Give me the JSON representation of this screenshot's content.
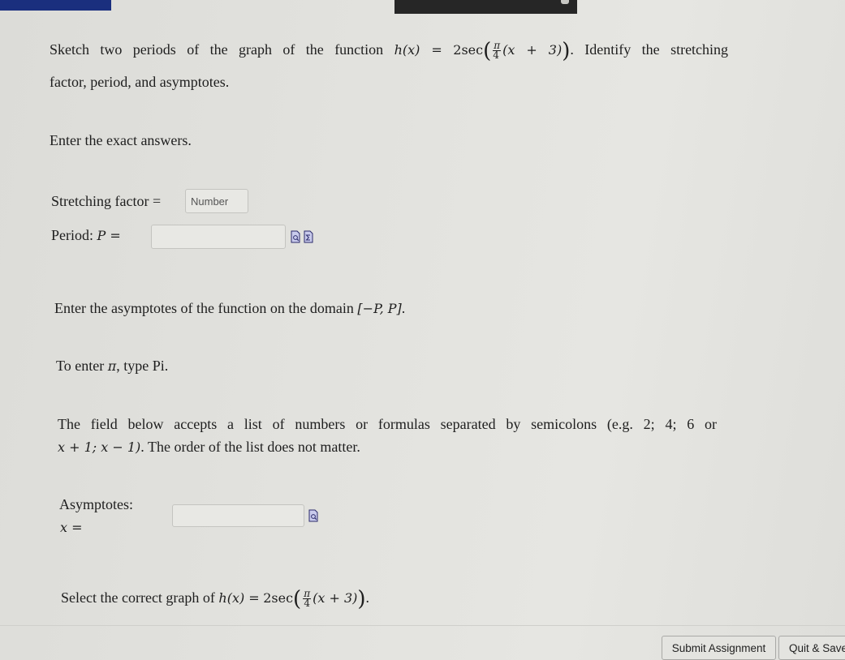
{
  "top_bar": {
    "brand_color": "#1a2f7e",
    "dark_panel_color": "#262626"
  },
  "question": {
    "line1_prefix": "Sketch two periods of the graph of the function",
    "function_lhs": "h(x) =",
    "function_coef": "2",
    "function_trig": "sec",
    "frac_num": "π",
    "frac_den": "4",
    "function_arg": "(x + 3)",
    "line1_suffix": ". Identify the stretching",
    "line2": "factor, period, and asymptotes."
  },
  "instructions": {
    "exact": "Enter the exact answers."
  },
  "stretching": {
    "label": "Stretching factor =",
    "placeholder": "Number",
    "value": ""
  },
  "period": {
    "label_text": "Period:",
    "label_math": "P =",
    "value": "",
    "icons": [
      "preview-icon",
      "equation-editor-icon"
    ]
  },
  "asymptote_instructions": {
    "domain_text": "Enter the asymptotes of the function on the domain",
    "domain_math": "[−P, P]",
    "domain_end": ".",
    "pi_text_prefix": "To enter",
    "pi_symbol": "π",
    "pi_text_suffix": ", type Pi.",
    "list_line1": "The field below accepts a list of numbers or formulas separated by semicolons (e.g. 2; 4; 6 or",
    "list_line2_math": "x + 1; x − 1)",
    "list_line2_text": ". The order of the list does not matter."
  },
  "asymptotes": {
    "label": "Asymptotes:",
    "var_label": "x =",
    "value": "",
    "icons": [
      "preview-icon"
    ]
  },
  "graph_select": {
    "prefix": "Select the correct graph of",
    "function_lhs": "h(x) =",
    "function_coef": "2",
    "function_trig": "sec",
    "frac_num": "π",
    "frac_den": "4",
    "function_arg": "(x + 3)",
    "suffix": "."
  },
  "footer": {
    "submit_label": "Submit Assignment",
    "quit_label": "Quit & Save"
  }
}
